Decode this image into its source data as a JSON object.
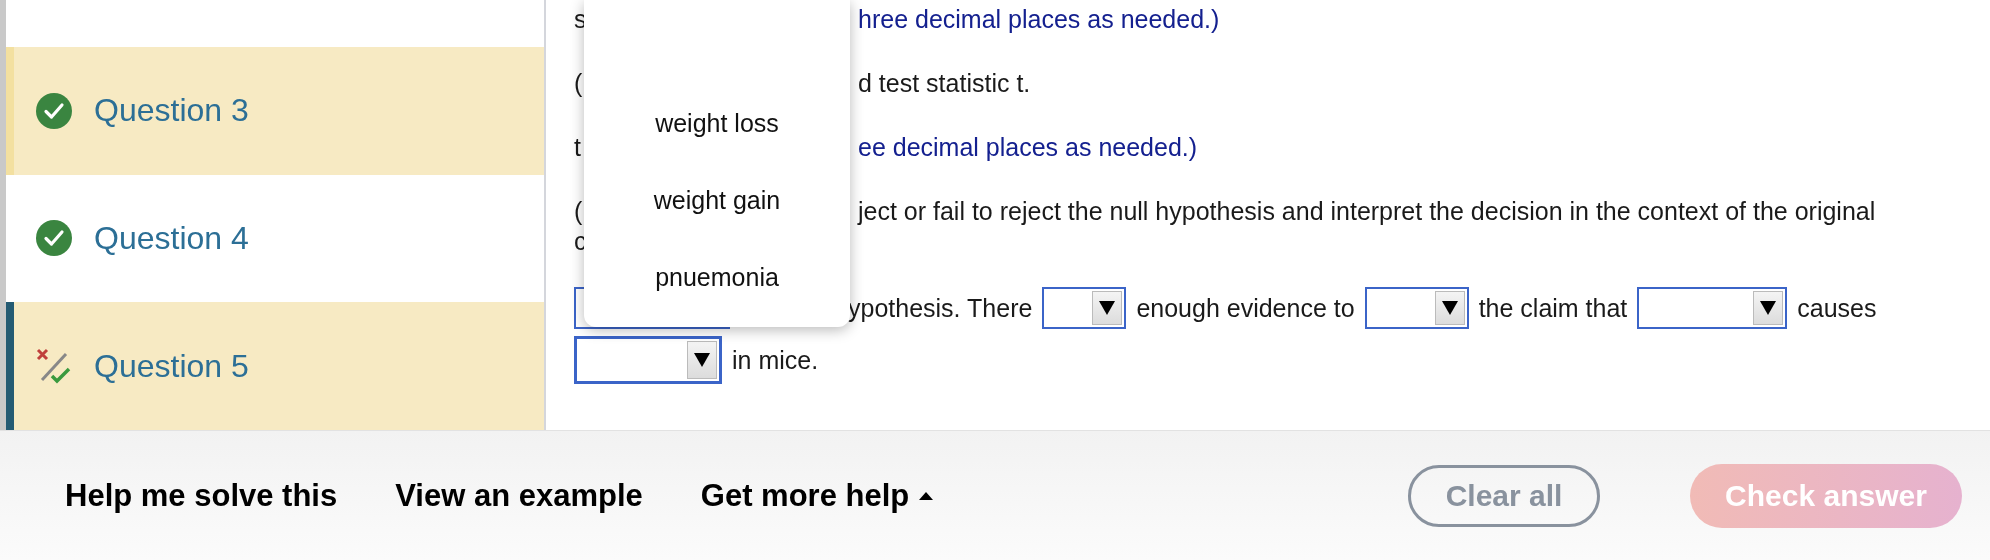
{
  "sidebar": {
    "items": [
      {
        "label": "Question 3",
        "kind": "correct",
        "highlighted": true,
        "selected": false
      },
      {
        "label": "Question 4",
        "kind": "correct",
        "highlighted": false,
        "selected": false
      },
      {
        "label": "Question 5",
        "kind": "partial",
        "highlighted": true,
        "selected": true
      }
    ]
  },
  "question": {
    "paragraphs": [
      {
        "lines": [
          {
            "left": "s",
            "right": "hree decimal places as needed.)",
            "kind": "hint"
          }
        ]
      },
      {
        "lines": [
          {
            "left": "(",
            "right": "d test statistic t.",
            "kind": "text"
          }
        ]
      },
      {
        "lines": [
          {
            "left": "t",
            "right": "ee decimal places as needed.)",
            "kind": "hint"
          }
        ]
      },
      {
        "lines": [
          {
            "left": "(",
            "right": "ject or fail to reject the null hypothesis and interpret the decision in the context of the original",
            "kind": "text"
          },
          {
            "left": "c",
            "kind": "text"
          }
        ]
      }
    ],
    "answer_rows": [
      {
        "parts": [
          {
            "kind": "select",
            "focused": false
          },
          {
            "kind": "text",
            "text": "ypothesis. There"
          },
          {
            "kind": "select",
            "focused": false
          },
          {
            "kind": "text",
            "text": "enough evidence to"
          },
          {
            "kind": "select",
            "focused": false
          },
          {
            "kind": "text",
            "text": "the claim that"
          },
          {
            "kind": "select",
            "focused": false
          },
          {
            "kind": "text",
            "text": "causes"
          }
        ]
      },
      {
        "parts": [
          {
            "kind": "select",
            "focused": true
          },
          {
            "kind": "text",
            "text": "in mice."
          }
        ]
      }
    ]
  },
  "dropdown_menu": {
    "options": [
      {
        "label": "weight loss"
      },
      {
        "label": "weight gain"
      },
      {
        "label": "pnuemonia"
      }
    ]
  },
  "footer": {
    "links": [
      {
        "label": "Help me solve this",
        "caret": false
      },
      {
        "label": "View an example",
        "caret": false
      },
      {
        "label": "Get more help",
        "caret": true
      }
    ],
    "buttons": [
      {
        "label": "Clear all",
        "kind": "outline",
        "disabled": false
      },
      {
        "label": "Check answer",
        "kind": "primary",
        "disabled": true
      }
    ]
  }
}
